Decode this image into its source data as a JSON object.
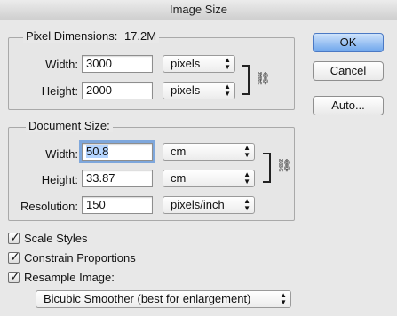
{
  "window": {
    "title": "Image Size"
  },
  "pixel_dimensions": {
    "title": "Pixel Dimensions:",
    "size": "17.2M",
    "width_label": "Width:",
    "width_value": "3000",
    "width_unit": "pixels",
    "height_label": "Height:",
    "height_value": "2000",
    "height_unit": "pixels"
  },
  "document_size": {
    "title": "Document Size:",
    "width_label": "Width:",
    "width_value": "50.8",
    "width_unit": "cm",
    "height_label": "Height:",
    "height_value": "33.87",
    "height_unit": "cm",
    "resolution_label": "Resolution:",
    "resolution_value": "150",
    "resolution_unit": "pixels/inch"
  },
  "buttons": {
    "ok": "OK",
    "cancel": "Cancel",
    "auto": "Auto..."
  },
  "options": {
    "scale_styles": {
      "label": "Scale Styles",
      "checked": true
    },
    "constrain_proportions": {
      "label": "Constrain Proportions",
      "checked": true
    },
    "resample_image": {
      "label": "Resample Image:",
      "checked": true
    }
  },
  "resample_method": "Bicubic Smoother (best for enlargement)",
  "icons": {
    "link": "chain-link-icon",
    "popup_arrows": "up-down-arrows-icon",
    "check": "checkmark-icon"
  }
}
